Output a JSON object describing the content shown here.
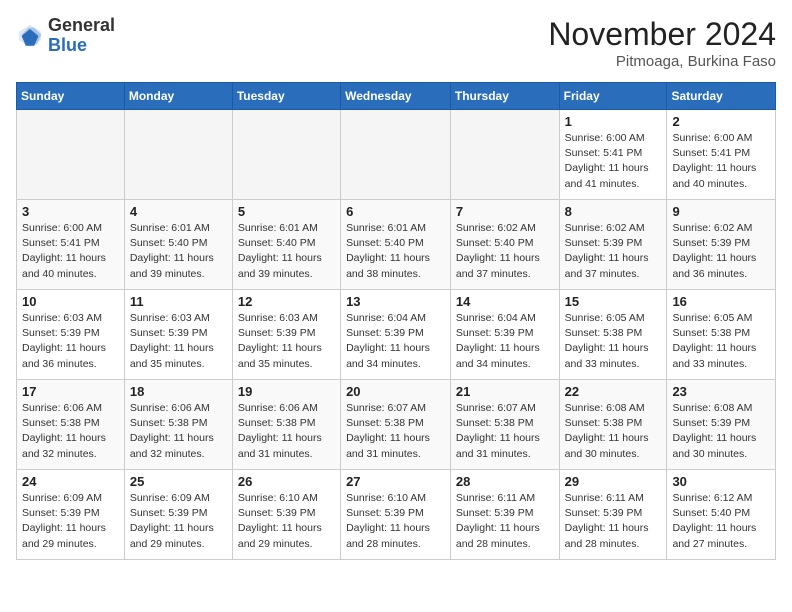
{
  "header": {
    "logo_general": "General",
    "logo_blue": "Blue",
    "month_title": "November 2024",
    "subtitle": "Pitmoaga, Burkina Faso"
  },
  "weekdays": [
    "Sunday",
    "Monday",
    "Tuesday",
    "Wednesday",
    "Thursday",
    "Friday",
    "Saturday"
  ],
  "weeks": [
    [
      {
        "day": "",
        "info": ""
      },
      {
        "day": "",
        "info": ""
      },
      {
        "day": "",
        "info": ""
      },
      {
        "day": "",
        "info": ""
      },
      {
        "day": "",
        "info": ""
      },
      {
        "day": "1",
        "info": "Sunrise: 6:00 AM\nSunset: 5:41 PM\nDaylight: 11 hours and 41 minutes."
      },
      {
        "day": "2",
        "info": "Sunrise: 6:00 AM\nSunset: 5:41 PM\nDaylight: 11 hours and 40 minutes."
      }
    ],
    [
      {
        "day": "3",
        "info": "Sunrise: 6:00 AM\nSunset: 5:41 PM\nDaylight: 11 hours and 40 minutes."
      },
      {
        "day": "4",
        "info": "Sunrise: 6:01 AM\nSunset: 5:40 PM\nDaylight: 11 hours and 39 minutes."
      },
      {
        "day": "5",
        "info": "Sunrise: 6:01 AM\nSunset: 5:40 PM\nDaylight: 11 hours and 39 minutes."
      },
      {
        "day": "6",
        "info": "Sunrise: 6:01 AM\nSunset: 5:40 PM\nDaylight: 11 hours and 38 minutes."
      },
      {
        "day": "7",
        "info": "Sunrise: 6:02 AM\nSunset: 5:40 PM\nDaylight: 11 hours and 37 minutes."
      },
      {
        "day": "8",
        "info": "Sunrise: 6:02 AM\nSunset: 5:39 PM\nDaylight: 11 hours and 37 minutes."
      },
      {
        "day": "9",
        "info": "Sunrise: 6:02 AM\nSunset: 5:39 PM\nDaylight: 11 hours and 36 minutes."
      }
    ],
    [
      {
        "day": "10",
        "info": "Sunrise: 6:03 AM\nSunset: 5:39 PM\nDaylight: 11 hours and 36 minutes."
      },
      {
        "day": "11",
        "info": "Sunrise: 6:03 AM\nSunset: 5:39 PM\nDaylight: 11 hours and 35 minutes."
      },
      {
        "day": "12",
        "info": "Sunrise: 6:03 AM\nSunset: 5:39 PM\nDaylight: 11 hours and 35 minutes."
      },
      {
        "day": "13",
        "info": "Sunrise: 6:04 AM\nSunset: 5:39 PM\nDaylight: 11 hours and 34 minutes."
      },
      {
        "day": "14",
        "info": "Sunrise: 6:04 AM\nSunset: 5:39 PM\nDaylight: 11 hours and 34 minutes."
      },
      {
        "day": "15",
        "info": "Sunrise: 6:05 AM\nSunset: 5:38 PM\nDaylight: 11 hours and 33 minutes."
      },
      {
        "day": "16",
        "info": "Sunrise: 6:05 AM\nSunset: 5:38 PM\nDaylight: 11 hours and 33 minutes."
      }
    ],
    [
      {
        "day": "17",
        "info": "Sunrise: 6:06 AM\nSunset: 5:38 PM\nDaylight: 11 hours and 32 minutes."
      },
      {
        "day": "18",
        "info": "Sunrise: 6:06 AM\nSunset: 5:38 PM\nDaylight: 11 hours and 32 minutes."
      },
      {
        "day": "19",
        "info": "Sunrise: 6:06 AM\nSunset: 5:38 PM\nDaylight: 11 hours and 31 minutes."
      },
      {
        "day": "20",
        "info": "Sunrise: 6:07 AM\nSunset: 5:38 PM\nDaylight: 11 hours and 31 minutes."
      },
      {
        "day": "21",
        "info": "Sunrise: 6:07 AM\nSunset: 5:38 PM\nDaylight: 11 hours and 31 minutes."
      },
      {
        "day": "22",
        "info": "Sunrise: 6:08 AM\nSunset: 5:38 PM\nDaylight: 11 hours and 30 minutes."
      },
      {
        "day": "23",
        "info": "Sunrise: 6:08 AM\nSunset: 5:39 PM\nDaylight: 11 hours and 30 minutes."
      }
    ],
    [
      {
        "day": "24",
        "info": "Sunrise: 6:09 AM\nSunset: 5:39 PM\nDaylight: 11 hours and 29 minutes."
      },
      {
        "day": "25",
        "info": "Sunrise: 6:09 AM\nSunset: 5:39 PM\nDaylight: 11 hours and 29 minutes."
      },
      {
        "day": "26",
        "info": "Sunrise: 6:10 AM\nSunset: 5:39 PM\nDaylight: 11 hours and 29 minutes."
      },
      {
        "day": "27",
        "info": "Sunrise: 6:10 AM\nSunset: 5:39 PM\nDaylight: 11 hours and 28 minutes."
      },
      {
        "day": "28",
        "info": "Sunrise: 6:11 AM\nSunset: 5:39 PM\nDaylight: 11 hours and 28 minutes."
      },
      {
        "day": "29",
        "info": "Sunrise: 6:11 AM\nSunset: 5:39 PM\nDaylight: 11 hours and 28 minutes."
      },
      {
        "day": "30",
        "info": "Sunrise: 6:12 AM\nSunset: 5:40 PM\nDaylight: 11 hours and 27 minutes."
      }
    ]
  ]
}
